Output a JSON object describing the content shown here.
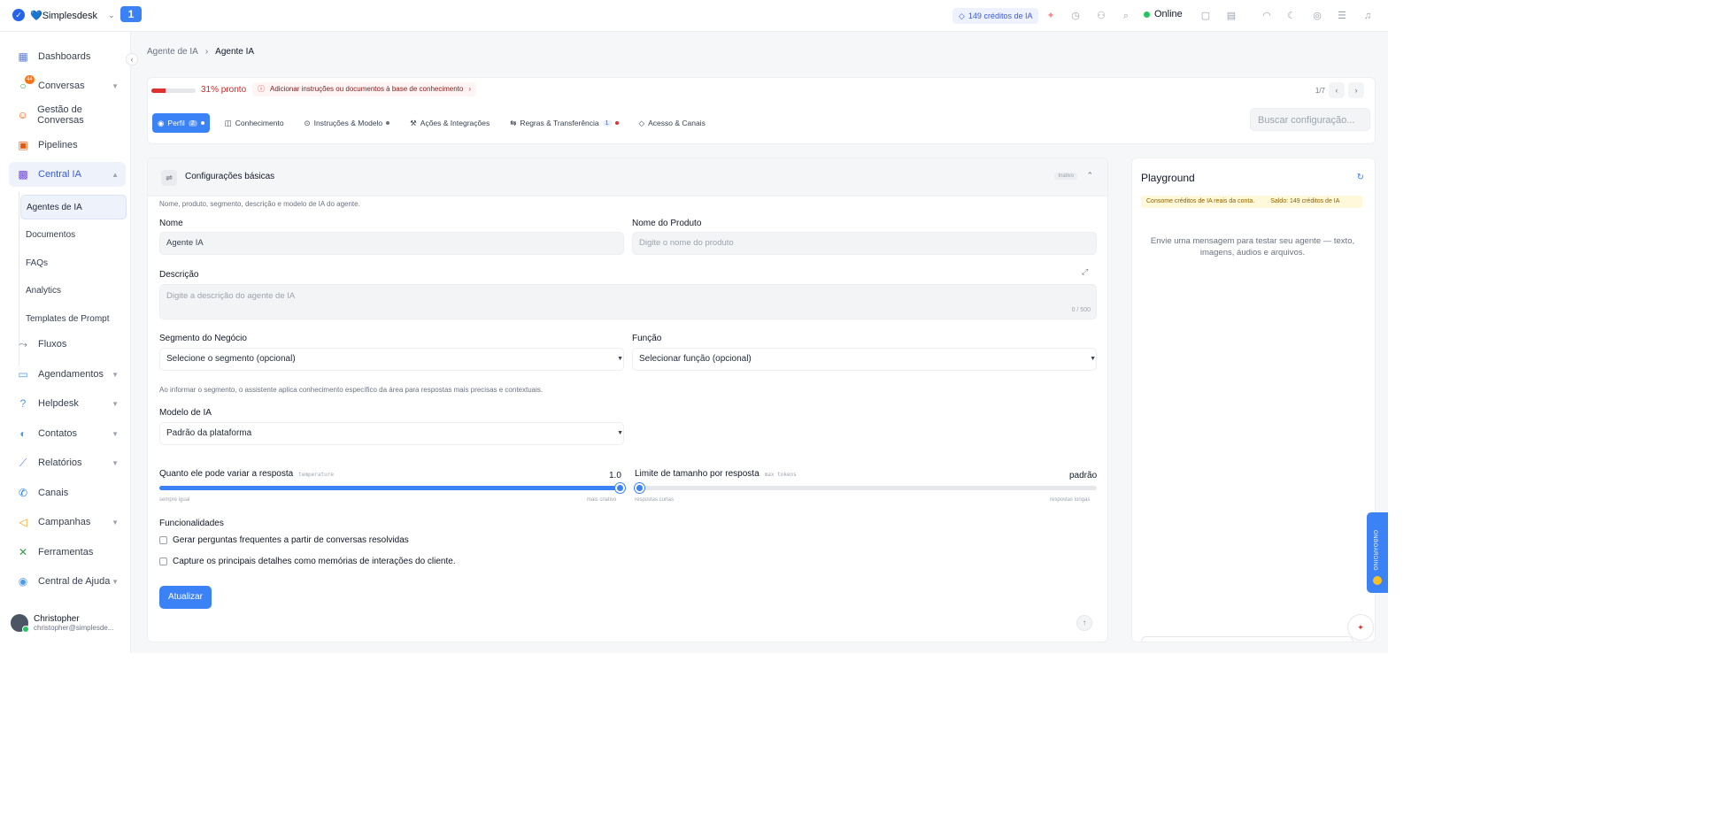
{
  "topbar": {
    "brand": "💙Simplesdesk",
    "step_badge": "1",
    "credits": "149 créditos de IA",
    "status": "Online"
  },
  "sidebar": {
    "items": [
      {
        "label": "Dashboards"
      },
      {
        "label": "Conversas",
        "badge": "44"
      },
      {
        "label": "Gestão de Conversas"
      },
      {
        "label": "Pipelines"
      },
      {
        "label": "Central IA"
      },
      {
        "label": "Fluxos"
      },
      {
        "label": "Agendamentos"
      },
      {
        "label": "Helpdesk"
      },
      {
        "label": "Contatos"
      },
      {
        "label": "Relatórios"
      },
      {
        "label": "Canais"
      },
      {
        "label": "Campanhas"
      },
      {
        "label": "Ferramentas"
      },
      {
        "label": "Central de Ajuda"
      }
    ],
    "sub_items": [
      "Agentes de IA",
      "Documentos",
      "FAQs",
      "Analytics",
      "Templates de Prompt"
    ],
    "user": {
      "name": "Christopher",
      "email": "christopher@simplesde..."
    }
  },
  "breadcrumb": [
    "Agente de IA",
    "Agente IA"
  ],
  "readiness": {
    "percent": 31,
    "label": "31% pronto",
    "warning": "Adicionar instruções ou documentos à base de conhecimento",
    "pager": "1/7"
  },
  "tabs": [
    {
      "label": "Perfil",
      "count": "2"
    },
    {
      "label": "Conhecimento"
    },
    {
      "label": "Instruções & Modelo"
    },
    {
      "label": "Ações & Integrações"
    },
    {
      "label": "Regras & Transferência",
      "count": "1"
    },
    {
      "label": "Acesso & Canais"
    }
  ],
  "search": {
    "placeholder": "Buscar configuração..."
  },
  "basic": {
    "title": "Configurações básicas",
    "tag": "Inativo",
    "subtitle": "Nome, produto, segmento, descrição e modelo de IA do agente.",
    "name_label": "Nome",
    "name_value": "Agente IA",
    "product_label": "Nome do Produto",
    "product_placeholder": "Digite o nome do produto",
    "desc_label": "Descrição",
    "desc_placeholder": "Digite a descrição do agente de IA",
    "desc_counter": "0 / 500",
    "segment_label": "Segmento do Negócio",
    "segment_value": "Selecione o segmento (opcional)",
    "role_label": "Função",
    "role_value": "Selecionar função (opcional)",
    "segment_hint": "Ao informar o segmento, o assistente aplica conhecimento específico da área para respostas mais precisas e contextuais.",
    "model_label": "Modelo de IA",
    "model_value": "Padrão da plataforma",
    "temp_label": "Quanto ele pode variar a resposta",
    "temp_tag": "temperature",
    "temp_value": "1.0",
    "temp_fill": 1.0,
    "temp_min": "sempre igual",
    "temp_max": "mais criativo",
    "tokens_label": "Limite de tamanho por resposta",
    "tokens_tag": "max tokens",
    "tokens_value": "padrão",
    "tokens_fill": 0.0,
    "tokens_min": "respostas curtas",
    "tokens_max": "respostas longas",
    "features_label": "Funcionalidades",
    "feature_1": "Gerar perguntas frequentes a partir de conversas resolvidas",
    "feature_2": "Capture os principais detalhes como memórias de interações do cliente.",
    "submit": "Atualizar"
  },
  "playground": {
    "title": "Playground",
    "notice": "Consome créditos de IA reais da conta.",
    "balance": "Saldo: 149 créditos de IA",
    "empty": "Envie uma mensagem para testar seu agente — texto, imagens, áudios e arquivos."
  },
  "onboarding": "ONBOARDING",
  "colors": {
    "accent": "#3b82f6",
    "danger": "#e03131",
    "success": "#22c55e"
  }
}
